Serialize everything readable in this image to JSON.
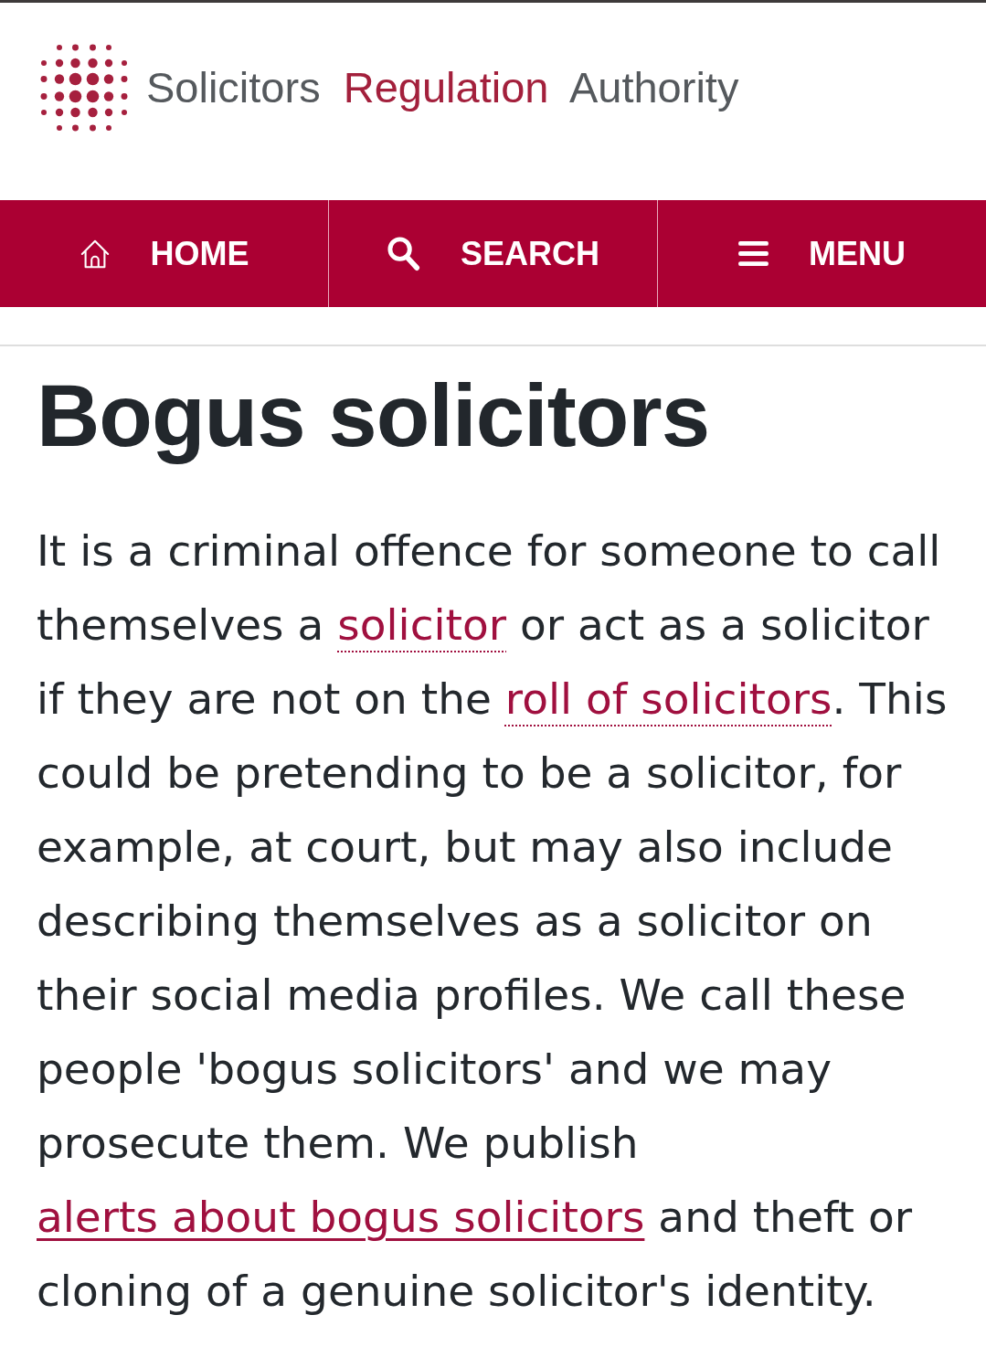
{
  "header": {
    "logo": {
      "words": [
        {
          "text": "Solicitors",
          "highlighted": false
        },
        {
          "text": "Regulation",
          "highlighted": true
        },
        {
          "text": "Authority",
          "highlighted": false
        }
      ]
    }
  },
  "nav": {
    "items": [
      {
        "kind": "home",
        "label": "HOME"
      },
      {
        "kind": "search",
        "label": "SEARCH"
      },
      {
        "kind": "menu",
        "label": "MENU"
      }
    ]
  },
  "article": {
    "title": "Bogus solicitors",
    "paragraph": [
      {
        "kind": "text",
        "text": "It is a criminal offence for someone to call themselves a "
      },
      {
        "kind": "glossary_link",
        "text": "solicitor"
      },
      {
        "kind": "text",
        "text": " or act as a solicitor if they are not on the "
      },
      {
        "kind": "glossary_link",
        "text": "roll of solicitors"
      },
      {
        "kind": "text",
        "text": ". This could be pretending to be a solicitor, for example, at court, but may also include describing themselves as a solicitor on their social media profiles. We call these people 'bogus solicitors' and we may prosecute them. We publish "
      },
      {
        "kind": "link",
        "text": "alerts about bogus solicitors"
      },
      {
        "kind": "text",
        "text": " and theft or cloning of a genuine solicitor's identity."
      }
    ]
  }
}
